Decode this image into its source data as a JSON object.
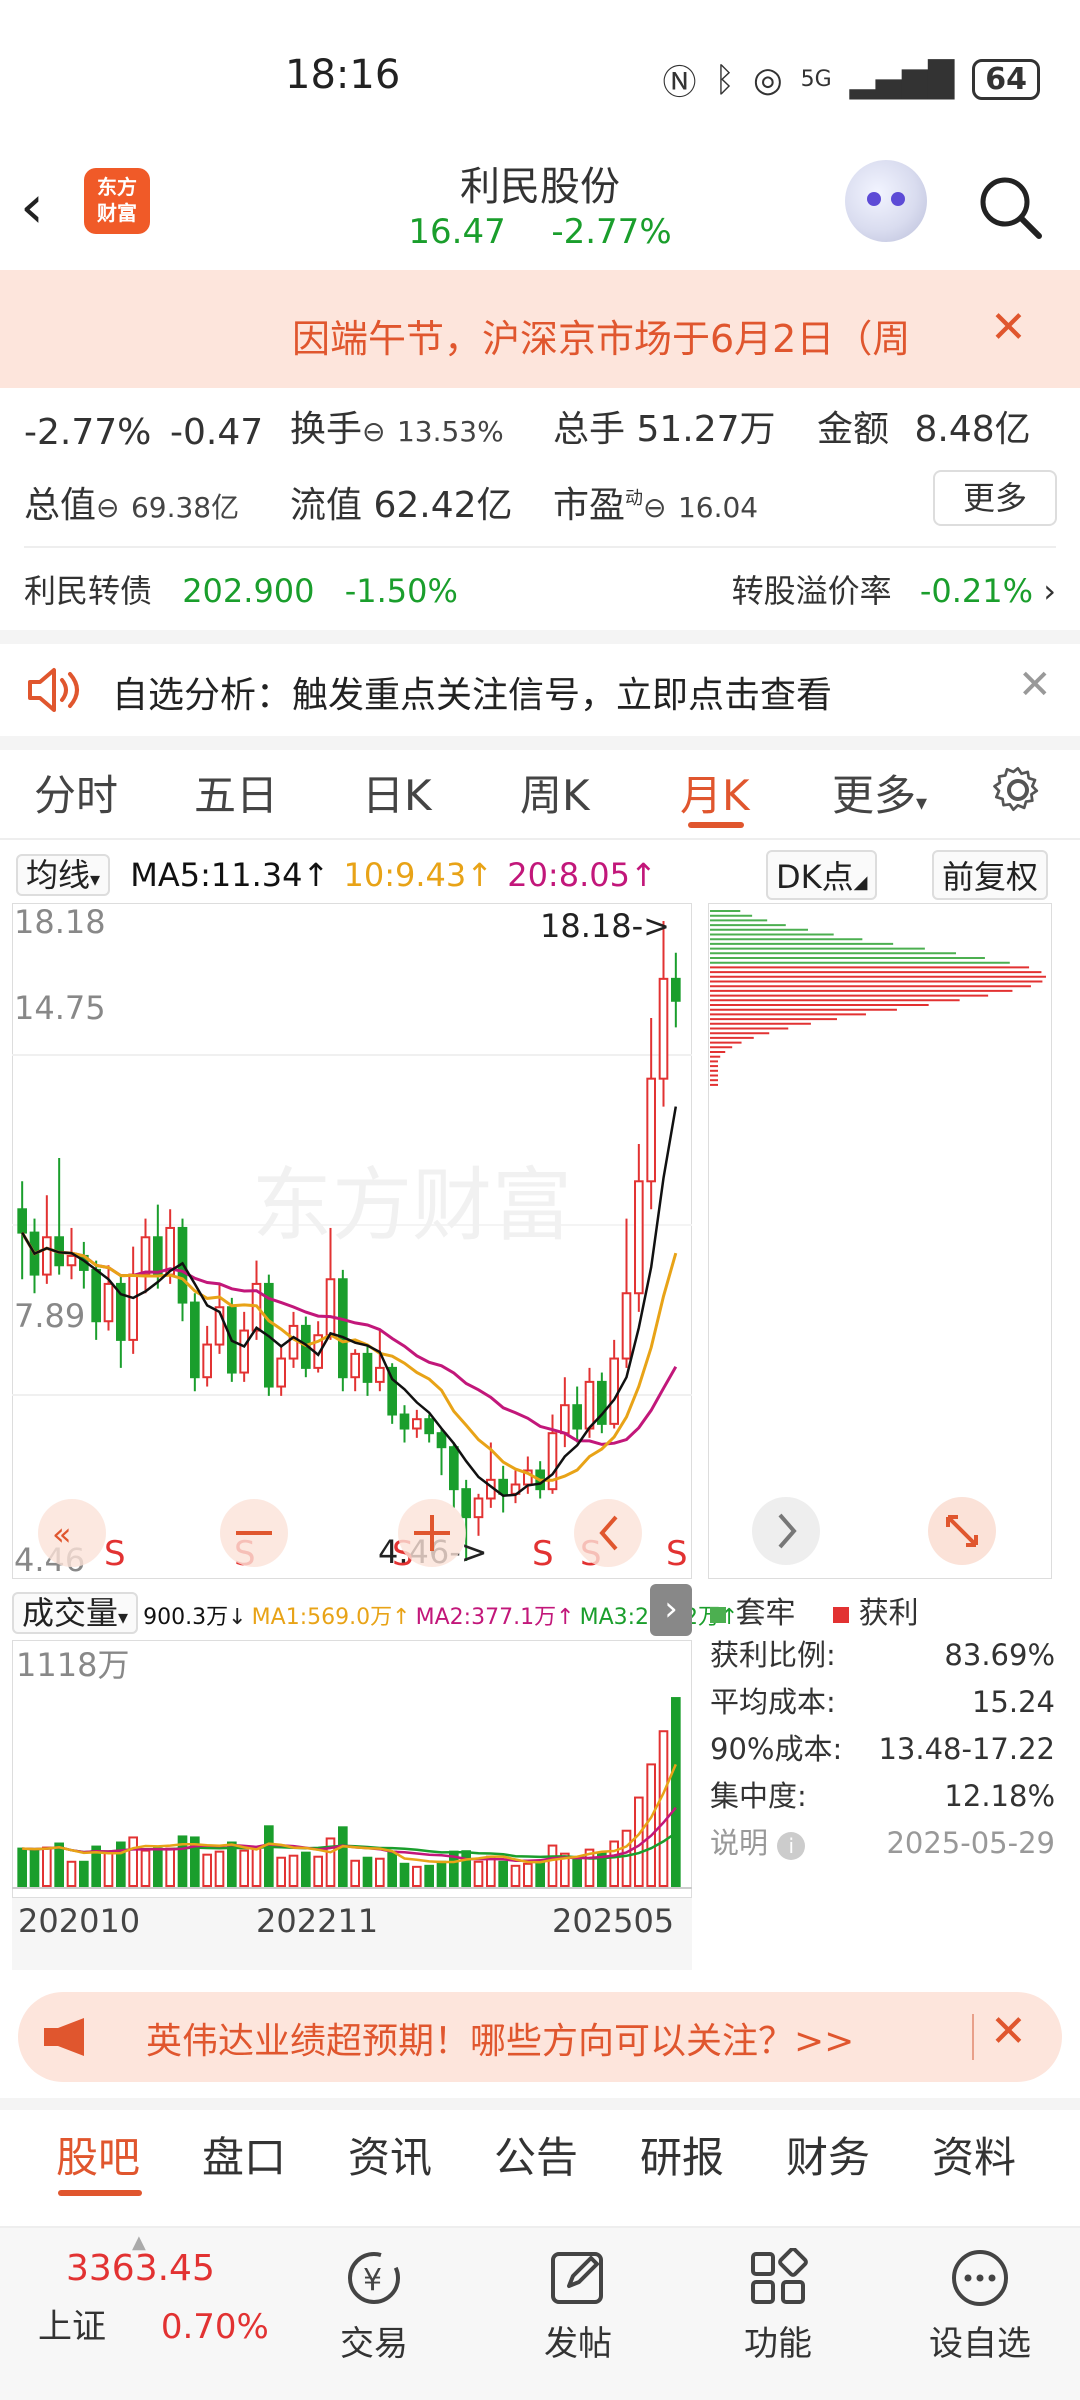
{
  "status_bar": {
    "time": "18:16",
    "battery": "64",
    "network": "5G"
  },
  "header": {
    "stock_name": "利民股份",
    "price": "16.47",
    "change_pct": "-2.77%",
    "logo_text_line1": "东方",
    "logo_text_line2": "财富"
  },
  "notice": {
    "text": "因端午节，沪深京市场于6月2日（周"
  },
  "quote": {
    "change_pct": "-2.77%",
    "change_abs": "-0.47",
    "turnover_label": "换手",
    "turnover_value": "13.53%",
    "volume_label": "总手",
    "volume_value": "51.27万",
    "amount_label": "金额",
    "amount_value": "8.48亿",
    "total_cap_label": "总值",
    "total_cap_value": "69.38亿",
    "float_cap_label": "流值",
    "float_cap_value": "62.42亿",
    "pe_label": "市盈",
    "pe_sup": "动",
    "pe_value": "16.04",
    "more_label": "更多"
  },
  "bond": {
    "name": "利民转债",
    "price": "202.900",
    "change": "-1.50%",
    "premium_label": "转股溢价率",
    "premium_value": "-0.21%"
  },
  "alert": {
    "text": "自选分析：触发重点关注信号，立即点击查看"
  },
  "kline_tabs": {
    "items": [
      "分时",
      "五日",
      "日K",
      "周K",
      "月K",
      "更多"
    ],
    "active_index": 4
  },
  "ma": {
    "selector": "均线",
    "ma5": "MA5:11.34",
    "ma10": "10:9.43",
    "ma20": "20:8.05",
    "dk_label": "DK点",
    "adjust_label": "前复权",
    "colors": {
      "ma5": "#111111",
      "ma10": "#e8a317",
      "ma20": "#c2177a"
    }
  },
  "chart_data": {
    "type": "candlestick",
    "y_ticks": [
      "18.18",
      "14.75",
      "7.89",
      "4.46"
    ],
    "high_marker": "18.18->",
    "low_marker": "4.46->",
    "signal_label": "S",
    "x_labels": [
      "202010",
      "202211",
      "202505"
    ],
    "watermark": "东方财富",
    "candles": [
      [
        12.0,
        11.5,
        12.6,
        10.5
      ],
      [
        11.5,
        10.6,
        11.8,
        10.2
      ],
      [
        10.6,
        11.4,
        12.3,
        10.4
      ],
      [
        11.4,
        10.8,
        13.1,
        10.6
      ],
      [
        10.8,
        11.0,
        11.6,
        10.5
      ],
      [
        11.0,
        10.7,
        11.3,
        10.3
      ],
      [
        10.7,
        9.6,
        10.9,
        9.2
      ],
      [
        9.6,
        10.4,
        10.8,
        9.4
      ],
      [
        10.4,
        9.2,
        10.6,
        8.6
      ],
      [
        9.2,
        10.6,
        11.2,
        8.9
      ],
      [
        10.6,
        11.4,
        11.8,
        10.2
      ],
      [
        11.4,
        10.6,
        12.1,
        10.3
      ],
      [
        10.6,
        11.6,
        12.0,
        10.4
      ],
      [
        11.6,
        10.0,
        11.8,
        9.6
      ],
      [
        10.0,
        8.4,
        10.2,
        8.1
      ],
      [
        8.4,
        9.1,
        9.5,
        8.2
      ],
      [
        9.1,
        9.9,
        10.4,
        8.9
      ],
      [
        9.9,
        8.5,
        10.1,
        8.3
      ],
      [
        8.5,
        9.4,
        9.8,
        8.3
      ],
      [
        9.4,
        10.4,
        10.9,
        9.2
      ],
      [
        10.4,
        8.2,
        10.6,
        8.0
      ],
      [
        8.2,
        8.8,
        9.1,
        8.0
      ],
      [
        8.8,
        9.5,
        9.8,
        8.6
      ],
      [
        9.5,
        8.6,
        9.7,
        8.4
      ],
      [
        8.6,
        9.3,
        9.6,
        8.5
      ],
      [
        9.3,
        10.5,
        11.6,
        9.2
      ],
      [
        10.5,
        8.4,
        10.7,
        8.1
      ],
      [
        8.4,
        8.9,
        9.0,
        8.1
      ],
      [
        8.9,
        8.3,
        9.1,
        8.0
      ],
      [
        8.3,
        8.6,
        9.4,
        8.1
      ],
      [
        8.6,
        7.6,
        8.7,
        7.4
      ],
      [
        7.6,
        7.3,
        7.8,
        7.0
      ],
      [
        7.3,
        7.5,
        7.7,
        7.1
      ],
      [
        7.5,
        7.2,
        7.6,
        7.0
      ],
      [
        7.2,
        6.9,
        7.3,
        6.3
      ],
      [
        6.9,
        6.0,
        7.0,
        5.6
      ],
      [
        6.0,
        5.4,
        6.2,
        4.46
      ],
      [
        5.4,
        5.8,
        5.9,
        5.0
      ],
      [
        5.8,
        6.2,
        7.0,
        5.6
      ],
      [
        6.2,
        5.9,
        6.5,
        5.5
      ],
      [
        5.9,
        6.1,
        6.4,
        5.7
      ],
      [
        6.1,
        6.4,
        6.7,
        5.9
      ],
      [
        6.4,
        6.0,
        6.6,
        5.8
      ],
      [
        6.0,
        7.2,
        7.6,
        5.9
      ],
      [
        7.2,
        7.8,
        8.4,
        6.9
      ],
      [
        7.8,
        7.3,
        8.2,
        7.0
      ],
      [
        7.3,
        8.3,
        8.6,
        7.1
      ],
      [
        8.3,
        7.4,
        8.5,
        7.2
      ],
      [
        7.4,
        8.8,
        9.2,
        7.3
      ],
      [
        8.8,
        10.2,
        11.8,
        8.6
      ],
      [
        10.2,
        12.6,
        13.4,
        9.8
      ],
      [
        12.6,
        14.8,
        16.1,
        12.0
      ],
      [
        14.8,
        16.94,
        18.18,
        14.2
      ],
      [
        16.94,
        16.47,
        17.5,
        15.9
      ]
    ],
    "volume_label": "成交量",
    "volume_latest": "900.3万",
    "volume_ma1": "MA1:569.0万",
    "volume_ma2": "MA2:377.1万",
    "volume_ma3": "MA3:241.2万",
    "volume_max_label": "1118万",
    "volume_colors": {
      "ma1": "#e8a317",
      "ma2": "#c2177a",
      "ma3": "#1a9e2c"
    }
  },
  "chip": {
    "legend_trapped": "套牢",
    "legend_profit": "获利",
    "profit_ratio_label": "获利比例:",
    "profit_ratio_value": "83.69%",
    "avg_cost_label": "平均成本:",
    "avg_cost_value": "15.24",
    "cost90_label": "90%成本:",
    "cost90_value": "13.48-17.22",
    "concentration_label": "集中度:",
    "concentration_value": "12.18%",
    "explain_label": "说明",
    "date": "2025-05-29",
    "green_rows": 12,
    "red_rows": 26
  },
  "promo": {
    "text": "英伟达业绩超预期！哪些方向可以关注？>>"
  },
  "bottom_tabs": {
    "items": [
      "股吧",
      "盘口",
      "资讯",
      "公告",
      "研报",
      "财务",
      "资料"
    ],
    "active_index": 0
  },
  "bottom_nav": {
    "index_price": "3363.45",
    "index_name": "上证",
    "index_change": "0.70%",
    "trade": "交易",
    "post": "发帖",
    "function": "功能",
    "watchlist": "设自选"
  }
}
